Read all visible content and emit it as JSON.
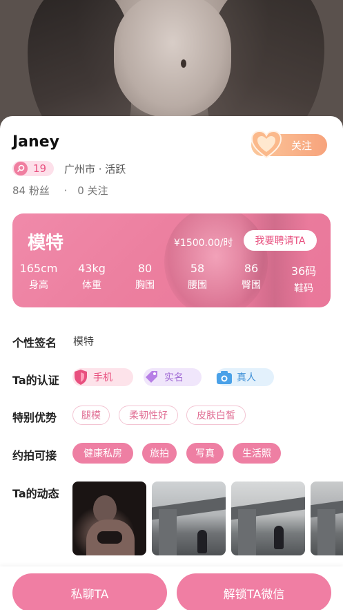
{
  "profile": {
    "name": "Janey",
    "level": "19",
    "location": "广州市 · 活跃",
    "followers": "84 粉丝",
    "separator": "·",
    "following": "0 关注",
    "follow_label": "关注"
  },
  "model_card": {
    "title": "模特",
    "price": "¥1500.00/时",
    "hire_label": "我要聘请TA",
    "measures": [
      {
        "value": "165cm",
        "label": "身高"
      },
      {
        "value": "43kg",
        "label": "体重"
      },
      {
        "value": "80",
        "label": "胸围"
      },
      {
        "value": "58",
        "label": "腰围"
      },
      {
        "value": "86",
        "label": "臀围"
      },
      {
        "value": "36码",
        "label": "鞋码"
      }
    ]
  },
  "info": {
    "signature_label": "个性签名",
    "signature_value": "模特",
    "cert_label": "Ta的认证",
    "certs": [
      {
        "label": "手机",
        "icon": "shield-icon",
        "color": "#e8507f",
        "bg": "#fde3ea"
      },
      {
        "label": "实名",
        "icon": "tag-icon",
        "color": "#a36ed6",
        "bg": "#f0e6fb"
      },
      {
        "label": "真人",
        "icon": "camera-icon",
        "color": "#3d8fd6",
        "bg": "#e3f1fc"
      }
    ],
    "advantages_label": "特别优势",
    "advantages": [
      "腿模",
      "柔韧性好",
      "皮肤白皙"
    ],
    "shoot_label": "约拍可接",
    "shoot_types": [
      "健康私房",
      "旅拍",
      "写真",
      "生活照"
    ],
    "moments_label": "Ta的动态"
  },
  "actions": {
    "chat_label": "私聊TA",
    "unlock_label": "解锁TA微信"
  },
  "colors": {
    "accent": "#f07ea3",
    "follow_gradient_start": "#fbc79b",
    "follow_gradient_end": "#f7a37c"
  }
}
